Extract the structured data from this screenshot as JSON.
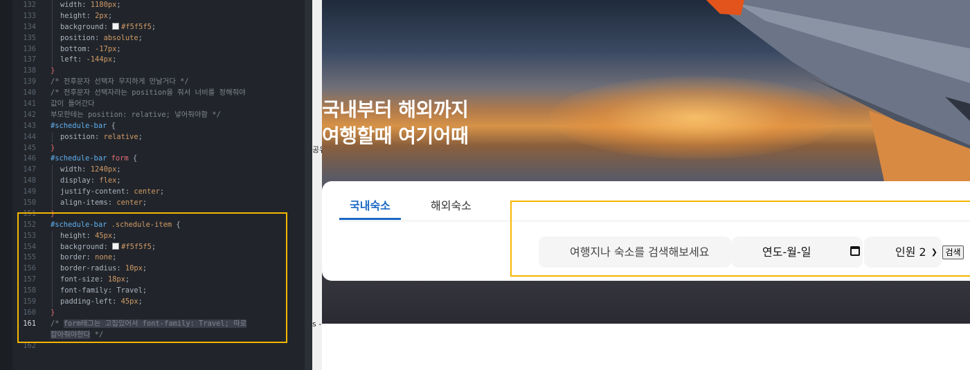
{
  "editor": {
    "lines": [
      {
        "n": "132",
        "parts": [
          {
            "t": "width",
            "c": "k"
          },
          {
            "t": ": ",
            "c": "k"
          },
          {
            "t": "1180px",
            "c": "v"
          },
          {
            "t": ";",
            "c": "k"
          }
        ]
      },
      {
        "n": "133",
        "parts": [
          {
            "t": "height",
            "c": "k"
          },
          {
            "t": ": ",
            "c": "k"
          },
          {
            "t": "2px",
            "c": "v"
          },
          {
            "t": ";",
            "c": "k"
          }
        ]
      },
      {
        "n": "134",
        "parts": [
          {
            "t": "background",
            "c": "k"
          },
          {
            "t": ": ",
            "c": "k"
          },
          {
            "t": "#f5f5f5",
            "c": "v",
            "sw": true
          },
          {
            "t": ";",
            "c": "k"
          }
        ]
      },
      {
        "n": "135",
        "parts": [
          {
            "t": "position",
            "c": "k"
          },
          {
            "t": ": ",
            "c": "k"
          },
          {
            "t": "absolute",
            "c": "v"
          },
          {
            "t": ";",
            "c": "k"
          }
        ]
      },
      {
        "n": "136",
        "parts": [
          {
            "t": "bottom",
            "c": "k"
          },
          {
            "t": ": ",
            "c": "k"
          },
          {
            "t": "-17px",
            "c": "v"
          },
          {
            "t": ";",
            "c": "k"
          }
        ]
      },
      {
        "n": "137",
        "parts": [
          {
            "t": "left",
            "c": "k"
          },
          {
            "t": ": ",
            "c": "k"
          },
          {
            "t": "-144px",
            "c": "v"
          },
          {
            "t": ";",
            "c": "k"
          }
        ]
      },
      {
        "n": "138",
        "parts": [
          {
            "t": "}",
            "c": "p"
          }
        ],
        "outer": true
      },
      {
        "n": "139",
        "parts": [
          {
            "t": "/* 전후문자 선택자 무지하게 만날거다 */",
            "c": "c"
          }
        ],
        "outer": true
      },
      {
        "n": "140",
        "parts": [
          {
            "t": "/* 전후문자 선택자라는 position을 줘서 너비를 정해줘야",
            "c": "c"
          }
        ],
        "outer": true
      },
      {
        "n": "141",
        "parts": [
          {
            "t": "값이 들어간다",
            "c": "c"
          }
        ],
        "outer": true
      },
      {
        "n": "142",
        "parts": [
          {
            "t": "부모한테는 position: relative; 넣어줘야함 */",
            "c": "c"
          }
        ],
        "outer": true
      },
      {
        "n": "143",
        "parts": [
          {
            "t": "#schedule-bar",
            "c": "s"
          },
          {
            "t": " {",
            "c": "k"
          }
        ],
        "outer": true
      },
      {
        "n": "144",
        "parts": [
          {
            "t": "position",
            "c": "k"
          },
          {
            "t": ": ",
            "c": "k"
          },
          {
            "t": "relative",
            "c": "v"
          },
          {
            "t": ";",
            "c": "k"
          }
        ]
      },
      {
        "n": "145",
        "parts": [
          {
            "t": "}",
            "c": "p"
          }
        ],
        "outer": true
      },
      {
        "n": "146",
        "parts": [
          {
            "t": "#schedule-bar",
            "c": "s"
          },
          {
            "t": " form",
            "c": "p"
          },
          {
            "t": " {",
            "c": "k"
          }
        ],
        "outer": true
      },
      {
        "n": "147",
        "parts": [
          {
            "t": "width",
            "c": "k"
          },
          {
            "t": ": ",
            "c": "k"
          },
          {
            "t": "1240px",
            "c": "v"
          },
          {
            "t": ";",
            "c": "k"
          }
        ]
      },
      {
        "n": "148",
        "parts": [
          {
            "t": "display",
            "c": "k"
          },
          {
            "t": ": ",
            "c": "k"
          },
          {
            "t": "flex",
            "c": "v"
          },
          {
            "t": ";",
            "c": "k"
          }
        ]
      },
      {
        "n": "149",
        "parts": [
          {
            "t": "justify-content",
            "c": "k"
          },
          {
            "t": ": ",
            "c": "k"
          },
          {
            "t": "center",
            "c": "v"
          },
          {
            "t": ";",
            "c": "k"
          }
        ]
      },
      {
        "n": "150",
        "parts": [
          {
            "t": "align-items",
            "c": "k"
          },
          {
            "t": ": ",
            "c": "k"
          },
          {
            "t": "center",
            "c": "v"
          },
          {
            "t": ";",
            "c": "k"
          }
        ]
      },
      {
        "n": "151",
        "parts": [
          {
            "t": "}",
            "c": "p"
          }
        ],
        "outer": true
      },
      {
        "n": "152",
        "parts": [
          {
            "t": "#schedule-bar",
            "c": "s"
          },
          {
            "t": " .schedule-item",
            "c": "v"
          },
          {
            "t": " {",
            "c": "k"
          }
        ],
        "outer": true
      },
      {
        "n": "153",
        "parts": [
          {
            "t": "height",
            "c": "k"
          },
          {
            "t": ": ",
            "c": "k"
          },
          {
            "t": "45px",
            "c": "v"
          },
          {
            "t": ";",
            "c": "k"
          }
        ]
      },
      {
        "n": "154",
        "parts": [
          {
            "t": "background",
            "c": "k"
          },
          {
            "t": ": ",
            "c": "k"
          },
          {
            "t": "#f5f5f5",
            "c": "v",
            "sw": true
          },
          {
            "t": ";",
            "c": "k"
          }
        ]
      },
      {
        "n": "155",
        "parts": [
          {
            "t": "border",
            "c": "k"
          },
          {
            "t": ": ",
            "c": "k"
          },
          {
            "t": "none",
            "c": "v"
          },
          {
            "t": ";",
            "c": "k"
          }
        ]
      },
      {
        "n": "156",
        "parts": [
          {
            "t": "border-radius",
            "c": "k"
          },
          {
            "t": ": ",
            "c": "k"
          },
          {
            "t": "10px",
            "c": "v"
          },
          {
            "t": ";",
            "c": "k"
          }
        ]
      },
      {
        "n": "157",
        "parts": [
          {
            "t": "font-size",
            "c": "k"
          },
          {
            "t": ": ",
            "c": "k"
          },
          {
            "t": "18px",
            "c": "v"
          },
          {
            "t": ";",
            "c": "k"
          }
        ]
      },
      {
        "n": "158",
        "parts": [
          {
            "t": "font-family",
            "c": "k"
          },
          {
            "t": ": ",
            "c": "k"
          },
          {
            "t": "Travel",
            "c": "k"
          },
          {
            "t": ";",
            "c": "k"
          }
        ]
      },
      {
        "n": "159",
        "parts": [
          {
            "t": "padding-left",
            "c": "k"
          },
          {
            "t": ": ",
            "c": "k"
          },
          {
            "t": "45px",
            "c": "v"
          },
          {
            "t": ";",
            "c": "k"
          }
        ]
      },
      {
        "n": "160",
        "parts": [
          {
            "t": "}",
            "c": "p"
          }
        ],
        "outer": true
      },
      {
        "n": "161",
        "parts": [
          {
            "t": "/* ",
            "c": "c"
          },
          {
            "t": "form태그는 고집있어서 font-family: Travel; 따로",
            "c": "c",
            "hl": true
          }
        ],
        "outer": true,
        "cur": true
      },
      {
        "n": "",
        "parts": [
          {
            "t": "잡아줘야한다",
            "c": "c",
            "hl": true
          },
          {
            "t": " */",
            "c": "c"
          }
        ],
        "outer": true
      },
      {
        "n": "162",
        "parts": [],
        "outer": true
      }
    ]
  },
  "browser_edge": {
    "frag_a": "공유",
    "frag_b": "s -"
  },
  "hero": {
    "title_line1": "국내부터 해외까지",
    "title_line2": "여행할때 여기어때"
  },
  "tabs": [
    {
      "label": "국내숙소",
      "active": true
    },
    {
      "label": "해외숙소",
      "active": false
    }
  ],
  "form": {
    "search_placeholder": "여행지나 숙소를 검색해보세요",
    "date_placeholder": "연도-월-일",
    "people_value": "인원 2",
    "submit_label": "검색"
  },
  "colors": {
    "highlight_box": "#f6b600",
    "tab_active": "#1967c4",
    "field_bg": "#f5f5f5"
  }
}
